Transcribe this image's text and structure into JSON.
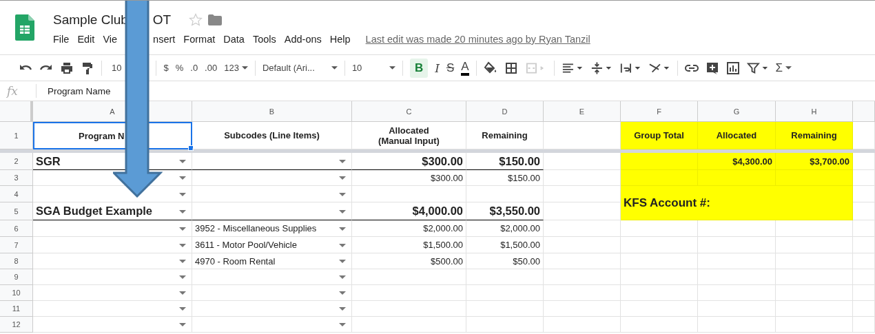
{
  "doc": {
    "title_start": "Sample Club",
    "title_end": "OT",
    "last_edit": "Last edit was made 20 minutes ago by Ryan Tanzil"
  },
  "menu": [
    {
      "label": "File"
    },
    {
      "label": "Edit"
    },
    {
      "label": "Vie"
    },
    {
      "label": "nsert"
    },
    {
      "label": "Format"
    },
    {
      "label": "Data"
    },
    {
      "label": "Tools"
    },
    {
      "label": "Add-ons"
    },
    {
      "label": "Help"
    }
  ],
  "toolbar": {
    "zoom": "10",
    "currency": "$",
    "percent": "%",
    "decimal_less": ".0",
    "decimal_more": ".00",
    "more_formats": "123",
    "font": "Default (Ari...",
    "font_size": "10",
    "bold": "B",
    "bold_selected": true,
    "italic": "I",
    "strike": "S",
    "text_color": "A",
    "sum": "Σ"
  },
  "formula_bar": {
    "label": "fx",
    "value": "Program Name"
  },
  "columns": [
    "A",
    "B",
    "C",
    "D",
    "E",
    "F",
    "G",
    "H"
  ],
  "rows": [
    {
      "number": "1",
      "kind": "header",
      "selected": true,
      "a": "Program N",
      "b": "Subcodes (Line Items)",
      "c": "Allocated\n(Manual Input)",
      "d": "Remaining"
    },
    {
      "number": "2",
      "kind": "group",
      "selected": false,
      "dropdown": true,
      "a": "SGR",
      "c": "$300.00",
      "d": "$150.00"
    },
    {
      "number": "3",
      "kind": "item",
      "selected": false,
      "dropdown": true,
      "c": "$300.00",
      "d": "$150.00"
    },
    {
      "number": "4",
      "kind": "item",
      "selected": false,
      "dropdown": true
    },
    {
      "number": "5",
      "kind": "group",
      "selected": false,
      "dropdown": true,
      "a": "SGA Budget Example",
      "c": "$4,000.00",
      "d": "$3,550.00"
    },
    {
      "number": "6",
      "kind": "item",
      "selected": false,
      "dropdown": true,
      "b": "3952 - Miscellaneous Supplies",
      "c": "$2,000.00",
      "d": "$2,000.00"
    },
    {
      "number": "7",
      "kind": "item",
      "selected": false,
      "dropdown": true,
      "b": "3611 - Motor Pool/Vehicle",
      "c": "$1,500.00",
      "d": "$1,500.00"
    },
    {
      "number": "8",
      "kind": "item",
      "selected": false,
      "dropdown": true,
      "b": "4970 - Room Rental",
      "c": "$500.00",
      "d": "$50.00"
    },
    {
      "number": "9",
      "kind": "item",
      "selected": false,
      "dropdown": true
    },
    {
      "number": "10",
      "kind": "item",
      "selected": false,
      "dropdown": true
    },
    {
      "number": "11",
      "kind": "item",
      "selected": false,
      "dropdown": true
    },
    {
      "number": "12",
      "kind": "item",
      "selected": false,
      "dropdown": true
    }
  ],
  "summary": {
    "headers": [
      "Group Total",
      "Allocated",
      "Remaining"
    ],
    "allocated_total": "$4,300.00",
    "remaining_total": "$3,700.00",
    "account_label": "KFS Account #:"
  }
}
